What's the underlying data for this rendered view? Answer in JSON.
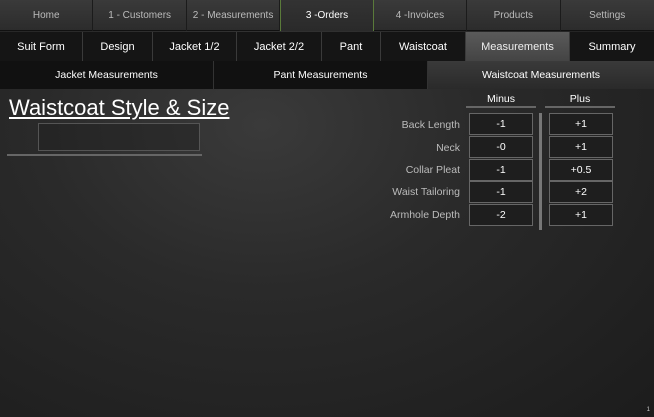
{
  "topnav": [
    {
      "label": "Home"
    },
    {
      "label": "1 - Customers"
    },
    {
      "label": "2 - Measurements"
    },
    {
      "label": "3 -Orders"
    },
    {
      "label": "4 -Invoices"
    },
    {
      "label": "Products"
    },
    {
      "label": "Settings"
    }
  ],
  "subnav": [
    {
      "label": "Suit Form"
    },
    {
      "label": "Design"
    },
    {
      "label": "Jacket 1/2"
    },
    {
      "label": "Jacket 2/2"
    },
    {
      "label": "Pant"
    },
    {
      "label": "Waistcoat"
    },
    {
      "label": "Measurements"
    },
    {
      "label": "Summary"
    }
  ],
  "thirdnav": [
    {
      "label": "Jacket Measurements"
    },
    {
      "label": "Pant Measurements"
    },
    {
      "label": "Waistcoat Measurements"
    }
  ],
  "page": {
    "title": "Waistcoat Style & Size",
    "style_value": "",
    "page_number": "1"
  },
  "grid": {
    "minus_label": "Minus",
    "plus_label": "Plus",
    "rows": [
      {
        "label": "Back Length",
        "minus": "-1",
        "plus": "+1"
      },
      {
        "label": "Neck",
        "minus": "-0",
        "plus": "+1"
      },
      {
        "label": "Collar Pleat",
        "minus": "-1",
        "plus": "+0.5"
      },
      {
        "label": "Waist Tailoring",
        "minus": "-1",
        "plus": "+2"
      },
      {
        "label": "Armhole Depth",
        "minus": "-2",
        "plus": "+1"
      }
    ]
  }
}
